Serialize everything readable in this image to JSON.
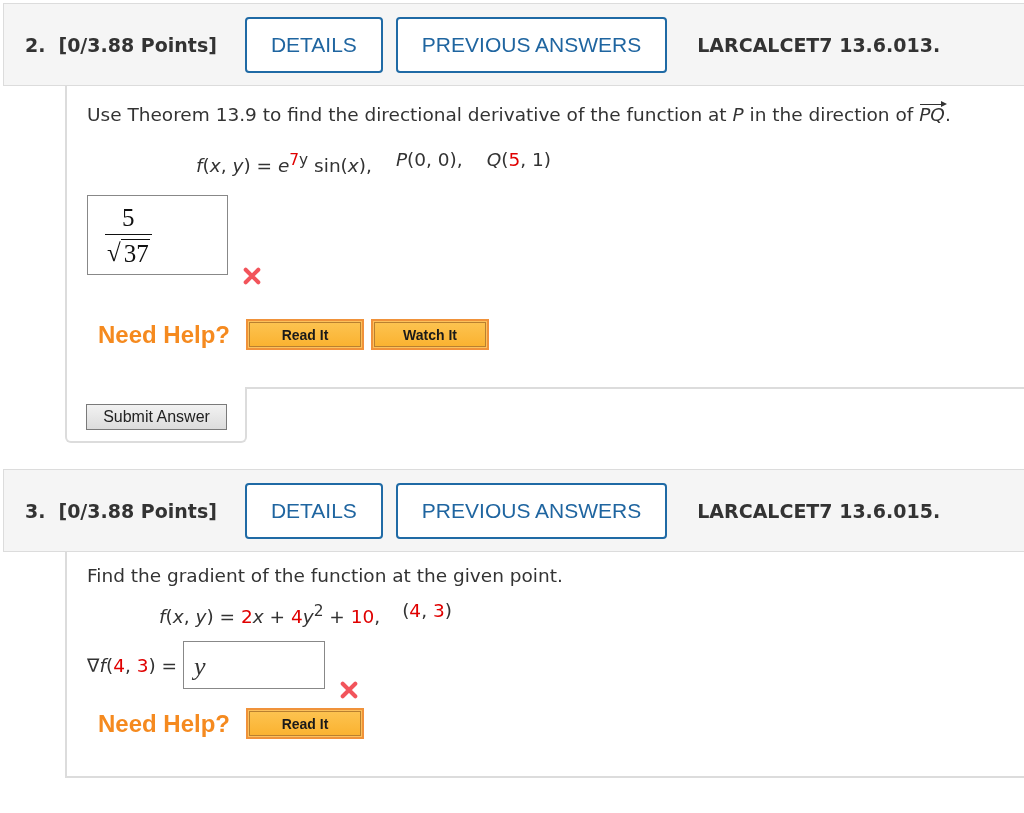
{
  "questions": [
    {
      "number": "2.",
      "points": "[0/3.88 Points]",
      "buttons": [
        "DETAILS",
        "PREVIOUS ANSWERS"
      ],
      "source": "LARCALCET7 13.6.013.",
      "prompt": {
        "text": "Use Theorem 13.9 to find the directional derivative of the function at *P* in the direction of ",
        "vector": "*PQ*",
        "end": "."
      },
      "formula": [
        {
          "segments": [
            {
              "text": "*f*(*x*, *y*) = *e*",
              "highlight": false
            },
            {
              "text": "$^{7}$",
              "highlight": true
            },
            {
              "text": "$^{y}$ sin(*x*),",
              "highlight": false
            }
          ]
        },
        {
          "segments": [
            {
              "text": "*P*(0, 0),",
              "highlight": false
            }
          ]
        },
        {
          "segments": [
            {
              "text": "*Q*(",
              "highlight": false
            },
            {
              "text": "5",
              "highlight": true
            },
            {
              "text": ", 1)",
              "highlight": false
            }
          ]
        }
      ],
      "answer": {
        "kind": "fraction",
        "numerator": "5",
        "root_sign": "√",
        "radicand": "37",
        "correct": false
      },
      "help": {
        "label": "Need Help?",
        "buttons": [
          "Read It",
          "Watch It"
        ]
      },
      "submit": "Submit Answer"
    },
    {
      "number": "3.",
      "points": "[0/3.88 Points]",
      "buttons": [
        "DETAILS",
        "PREVIOUS ANSWERS"
      ],
      "source": "LARCALCET7 13.6.015.",
      "prompt": {
        "text": "Find the gradient of the function at the given point."
      },
      "formula": [
        {
          "segments": [
            {
              "text": "*f*(*x*, *y*) = ",
              "highlight": false
            },
            {
              "text": "2",
              "highlight": true
            },
            {
              "text": "*x* + ",
              "highlight": false
            },
            {
              "text": "4",
              "highlight": true
            },
            {
              "text": "*y*$^{2}$ + ",
              "highlight": false
            },
            {
              "text": "10",
              "highlight": true
            },
            {
              "text": ",",
              "highlight": false
            }
          ]
        },
        {
          "segments": [
            {
              "text": "(",
              "highlight": false
            },
            {
              "text": "4",
              "highlight": true
            },
            {
              "text": ", ",
              "highlight": false
            },
            {
              "text": "3",
              "highlight": true
            },
            {
              "text": ")",
              "highlight": false
            }
          ]
        }
      ],
      "answer": {
        "kind": "input",
        "label": [
          {
            "text": "∇*f*(",
            "highlight": false
          },
          {
            "text": "4",
            "highlight": true
          },
          {
            "text": ", ",
            "highlight": false
          },
          {
            "text": "3",
            "highlight": true
          },
          {
            "text": ") =",
            "highlight": false
          }
        ],
        "value": "y",
        "correct": false
      },
      "help": {
        "label": "Need Help?",
        "buttons": [
          "Read It"
        ]
      }
    }
  ]
}
